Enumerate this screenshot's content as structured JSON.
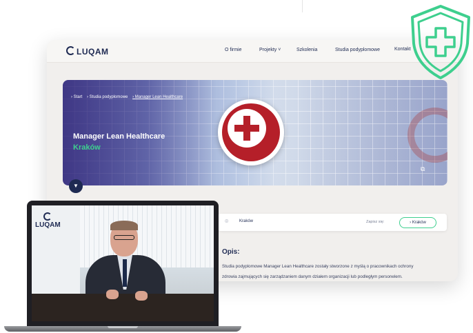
{
  "site": {
    "logo": "LUQAM"
  },
  "nav": {
    "items": [
      "O firmie",
      "Projekty ˅",
      "Szkolenia",
      "Studia podyplomowe"
    ],
    "contact": "Kontakt"
  },
  "hero": {
    "breadcrumb": [
      "› Start",
      "› Studia podyplomowe",
      "› Manager Lean Healthcare"
    ],
    "title": "Manager Lean Healthcare",
    "city": "Kraków"
  },
  "location": {
    "place": "Kraków",
    "signup_label": "Zapisz się:",
    "signup_button": "› Kraków"
  },
  "description": {
    "heading": "Opis:",
    "line1": "Studia podyplomowe Manager Lean Healthcare zostały stworzone z myślą o pracownikach ochrony",
    "line2": "zdrowia zajmujących się zarządzaniem danym działem organizacji lub podległym personelem."
  },
  "video": {
    "logo": "LUQAM"
  },
  "colors": {
    "navy": "#1e2a52",
    "accent_green": "#3ecf8e",
    "cross_red": "#b51f29"
  }
}
